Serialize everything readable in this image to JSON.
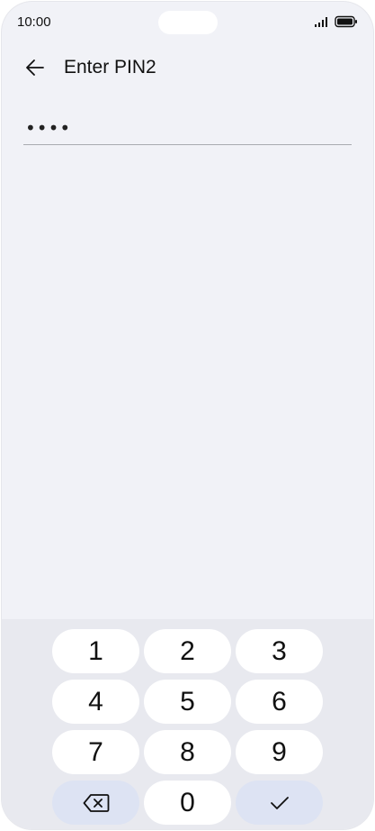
{
  "status_bar": {
    "time": "10:00",
    "icons": [
      "signal-icon",
      "battery-icon"
    ]
  },
  "header": {
    "back_icon": "arrow-left-icon",
    "title": "Enter PIN2"
  },
  "pin_field": {
    "value": "••••"
  },
  "keypad": {
    "keys": [
      "1",
      "2",
      "3",
      "4",
      "5",
      "6",
      "7",
      "8",
      "9",
      "0"
    ],
    "delete_icon": "backspace-icon",
    "confirm_icon": "check-icon"
  },
  "colors": {
    "background": "#f1f2f7",
    "keypad_background": "#e8e9ef",
    "key": "#ffffff",
    "action_key": "#dde3f3"
  }
}
